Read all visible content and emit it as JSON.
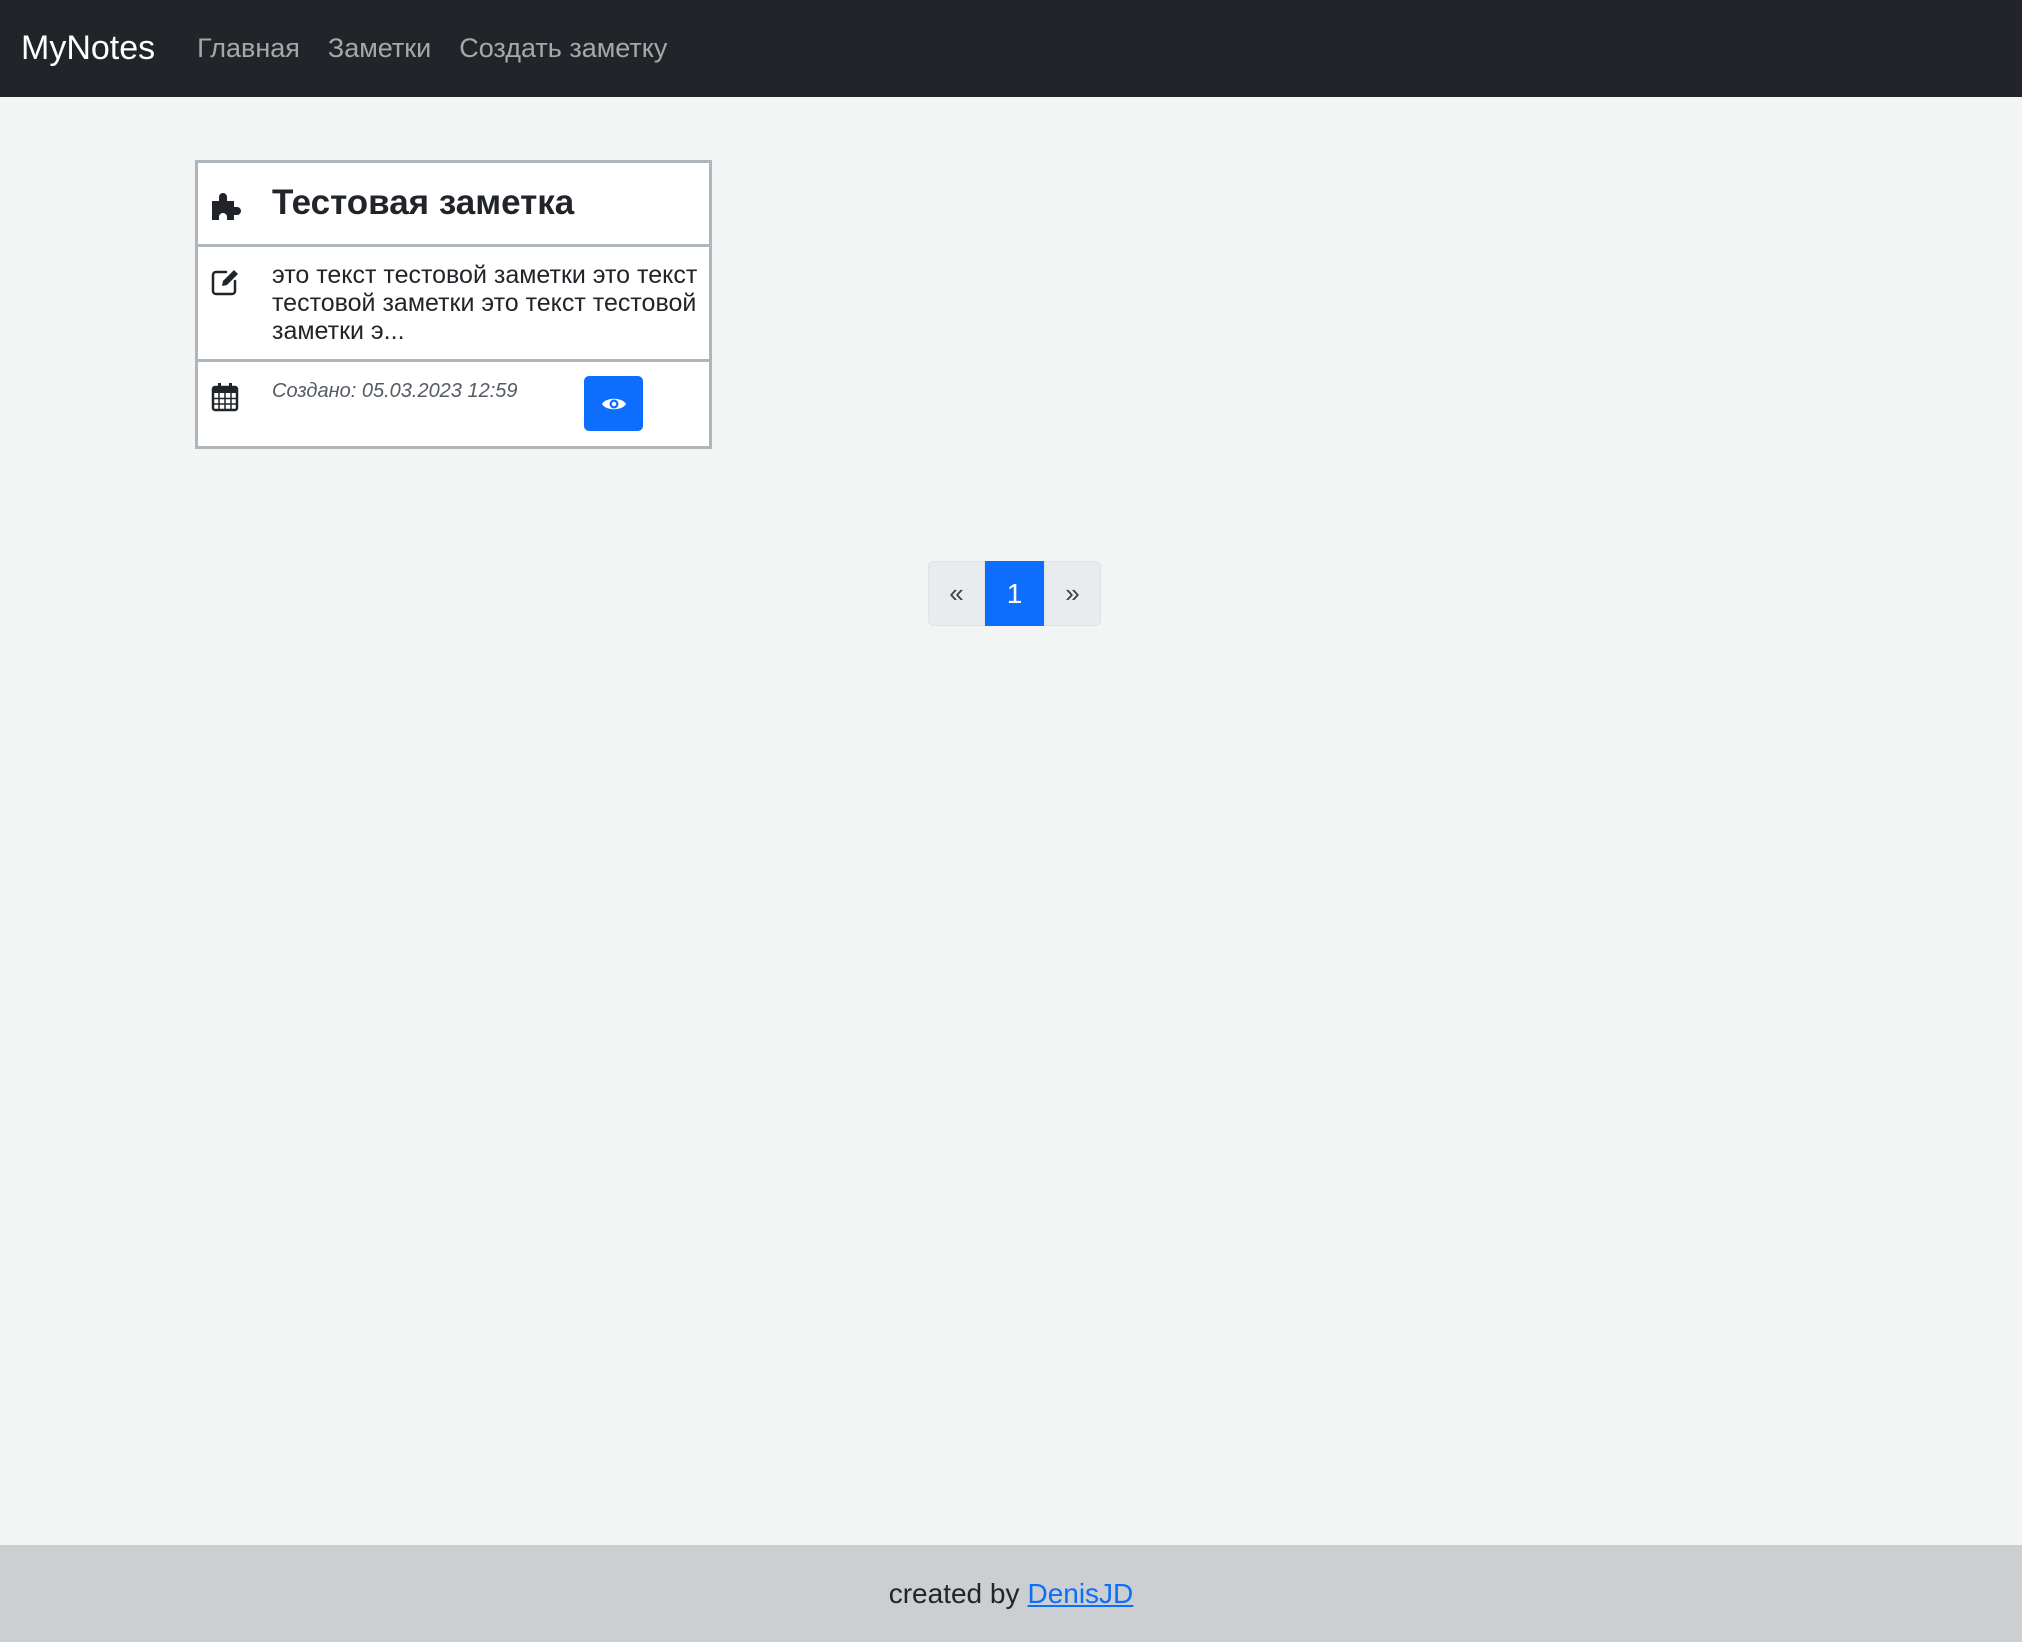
{
  "navbar": {
    "brand": "MyNotes",
    "links": [
      "Главная",
      "Заметки",
      "Создать заметку"
    ]
  },
  "note": {
    "title": "Тестовая заметка",
    "text": "это текст тестовой заметки это текст тестовой заметки это текст тестовой заметки э...",
    "created": "Создано: 05.03.2023 12:59",
    "icons": {
      "title": "puzzle-icon",
      "text": "edit-icon",
      "date": "calendar-icon",
      "view": "eye-icon"
    }
  },
  "pagination": {
    "prev": "«",
    "current": "1",
    "next": "»"
  },
  "footer": {
    "prefix": "created by",
    "author": "DenisJD"
  },
  "colors": {
    "navbar": "#212529",
    "page_bg": "#f3f5f4",
    "accent": "#0d6efd",
    "footer_bg": "#cbcfd1"
  }
}
